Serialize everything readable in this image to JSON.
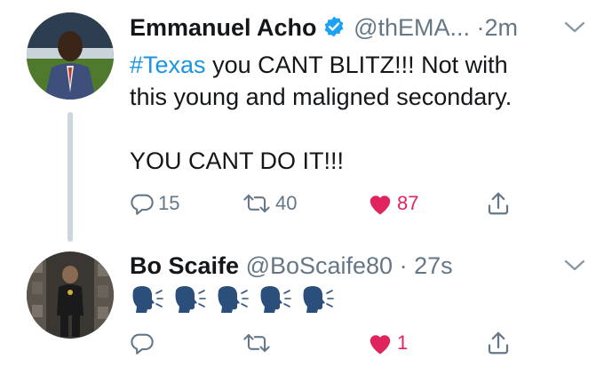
{
  "tweets": [
    {
      "name": "Emmanuel Acho",
      "handle": "@thEMA...",
      "dot": "·",
      "time": "2m",
      "hashtag": "#Texas",
      "text_line1_rest": " you CANT BLITZ!!! Not with",
      "text_line2": "this young and maligned secondary.",
      "text_line3": "YOU CANT DO IT!!!",
      "reply_count": "15",
      "retweet_count": "40",
      "like_count": "87",
      "liked": true,
      "verified": true
    },
    {
      "name": "Bo Scaife",
      "handle": "@BoScaife80",
      "dot": "·",
      "time": "27s",
      "emoji": [
        "speaking-head-emoji",
        "speaking-head-emoji",
        "speaking-head-emoji",
        "speaking-head-emoji",
        "speaking-head-emoji"
      ],
      "like_count": "1",
      "liked": true
    }
  ],
  "colors": {
    "like": "#e0245e",
    "hashtag": "#1b95e0",
    "secondary_text": "#657786",
    "verified": "#1da1f2",
    "thread_line": "#ccd6dd"
  }
}
